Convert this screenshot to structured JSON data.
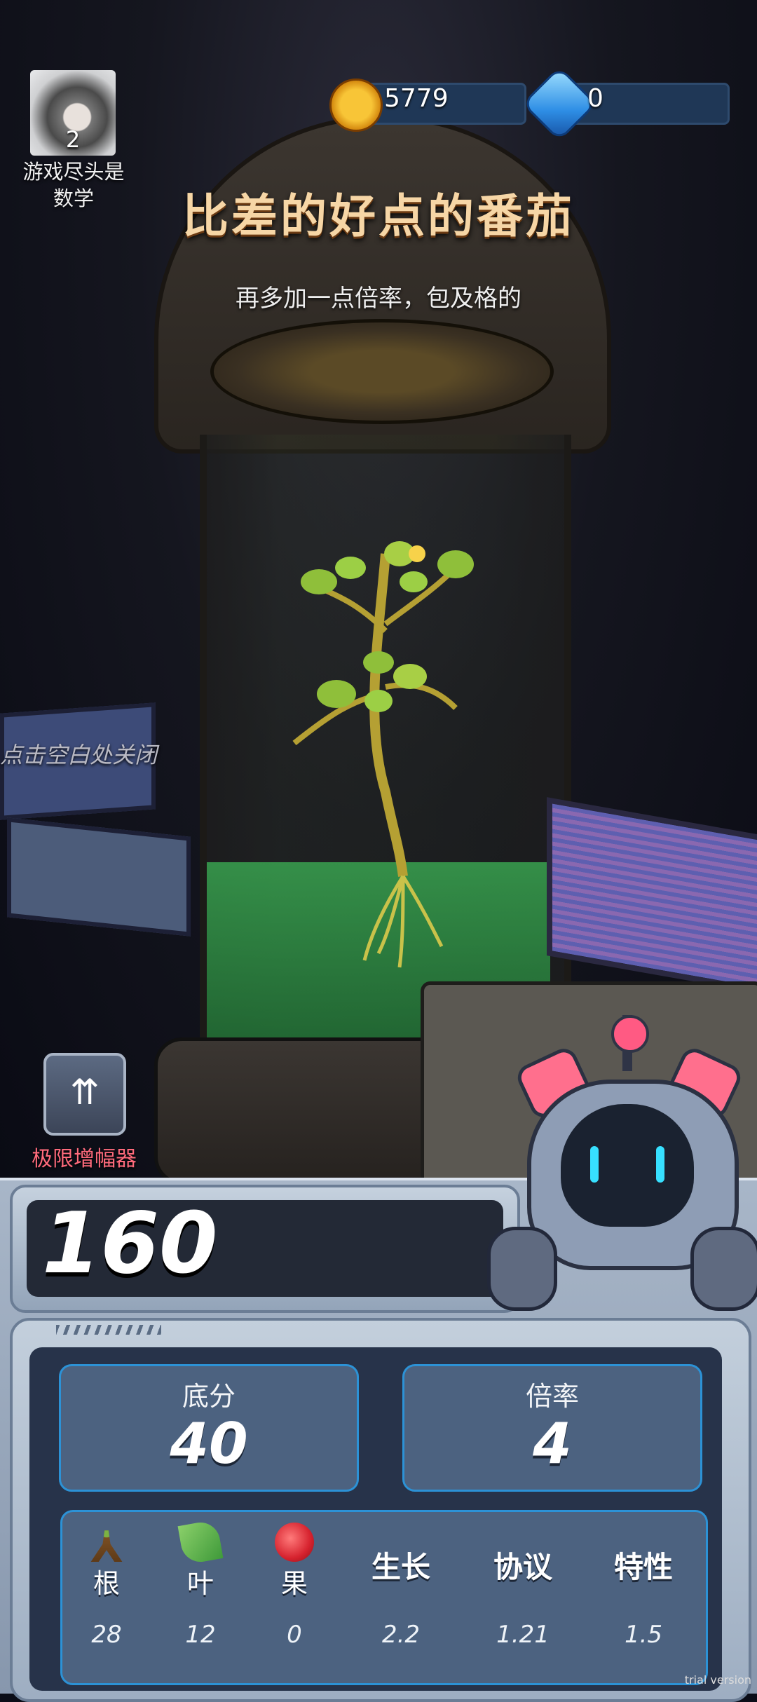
{
  "player": {
    "level": "2",
    "name_line1": "游戏尽头是",
    "name_line2": "数学"
  },
  "currency": {
    "coins": "5779",
    "gems": "0"
  },
  "plant": {
    "name": "比差的好点的番茄",
    "description": "再多加一点倍率，包及格的"
  },
  "hint": {
    "close": "点击空白处关闭"
  },
  "amplifier": {
    "label": "极限增幅器"
  },
  "score": {
    "total": "160"
  },
  "stats": {
    "base_label": "底分",
    "base_value": "40",
    "multiplier_label": "倍率",
    "multiplier_value": "4"
  },
  "attributes": [
    {
      "name": "根",
      "value": "28",
      "icon": "root-icon"
    },
    {
      "name": "叶",
      "value": "12",
      "icon": "leaf-icon"
    },
    {
      "name": "果",
      "value": "0",
      "icon": "fruit-icon"
    },
    {
      "name": "生长",
      "value": "2.2"
    },
    {
      "name": "协议",
      "value": "1.21"
    },
    {
      "name": "特性",
      "value": "1.5"
    }
  ],
  "watermark": "trial version"
}
